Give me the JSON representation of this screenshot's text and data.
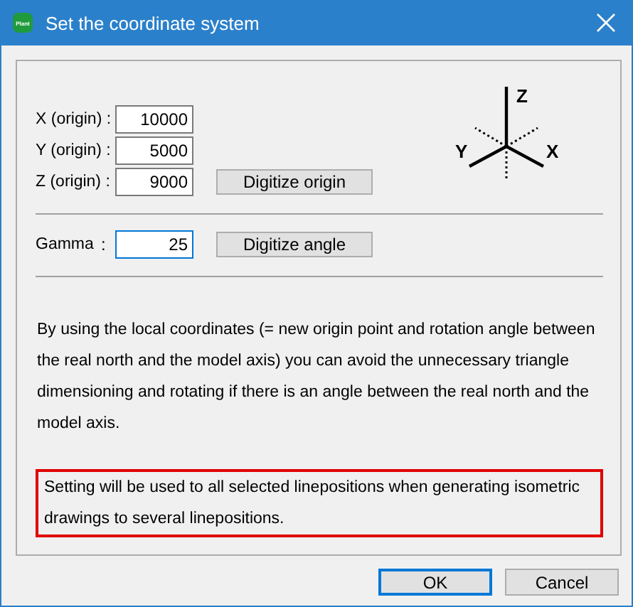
{
  "window": {
    "title": "Set the coordinate system",
    "app_badge": "Plant"
  },
  "origin_fields": [
    {
      "label": "X (origin) :",
      "value": "10000",
      "focused": false
    },
    {
      "label": "Y (origin) :",
      "value": "5000",
      "focused": false
    },
    {
      "label": "Z (origin) :",
      "value": "9000",
      "focused": false
    }
  ],
  "digitize_origin_button": "Digitize origin",
  "axes": {
    "z": "Z",
    "y": "Y",
    "x": "X"
  },
  "gamma": {
    "label": "Gamma",
    "colon": ":",
    "value": "25",
    "focused": true
  },
  "digitize_angle_button": "Digitize angle",
  "description": "By using the local coordinates (= new origin point and rotation angle between the real north and the model axis) you can avoid the unnecessary triangle dimensioning and rotating if there is an angle between the real north and the model axis.",
  "note": {
    "text": "Setting will be used to all selected linepositions when generating isometric drawings to several linepositions.",
    "highlighted": true
  },
  "buttons": [
    {
      "label": "OK",
      "default": true
    },
    {
      "label": "Cancel",
      "default": false
    }
  ]
}
